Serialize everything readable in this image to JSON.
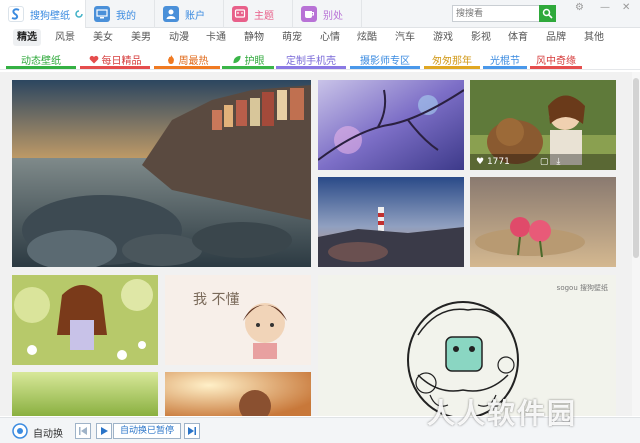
{
  "app": {
    "tabs": [
      {
        "label": "搜狗壁纸",
        "icon": "sogou-logo-icon",
        "color": "#3b8be0"
      },
      {
        "label": "我的",
        "icon": "monitor-icon",
        "color": "#4a90d9"
      },
      {
        "label": "账户",
        "icon": "user-icon",
        "color": "#4a90d9"
      },
      {
        "label": "主题",
        "icon": "theme-icon",
        "color": "#e8608a"
      },
      {
        "label": "别处",
        "icon": "cup-icon",
        "color": "#b872d6"
      }
    ],
    "search_placeholder": "搜搜看"
  },
  "categories": [
    "精选",
    "风景",
    "美女",
    "美男",
    "动漫",
    "卡通",
    "静物",
    "萌宠",
    "心情",
    "炫酷",
    "汽车",
    "游戏",
    "影视",
    "体育",
    "品牌",
    "其他"
  ],
  "specials": [
    {
      "label": "动态壁纸",
      "color": "#2fa93b",
      "underline": "#34b043"
    },
    {
      "label": "每日精品",
      "color": "#d63b3b",
      "underline": "#e54d4d"
    },
    {
      "label": "周最热",
      "color": "#e06a1a",
      "underline": "#f07a22"
    },
    {
      "label": "护眼",
      "color": "#2fa93b",
      "underline": "#3ab548"
    },
    {
      "label": "定制手机壳",
      "color": "#7a6ad8",
      "underline": "#8a79e4"
    },
    {
      "label": "摄影师专区",
      "color": "#3b8be0",
      "underline": "#4a98ea"
    },
    {
      "label": "匆匆那年",
      "color": "#d29a1a",
      "underline": "#e0a722"
    },
    {
      "label": "光棍节",
      "color": "#3b8be0",
      "underline": "#4a98ea"
    },
    {
      "label": "风中奇缘",
      "color": "#d63b3b",
      "underline": "#e54d4d"
    }
  ],
  "gallery": {
    "hover_count": "1771",
    "tile6_caption": "我 不懂",
    "tile8_brand": "sogou 搜狗壁纸"
  },
  "bottom": {
    "auto_label": "自动换",
    "status_label": "自动换已暂停"
  },
  "watermark": "人人软件园"
}
